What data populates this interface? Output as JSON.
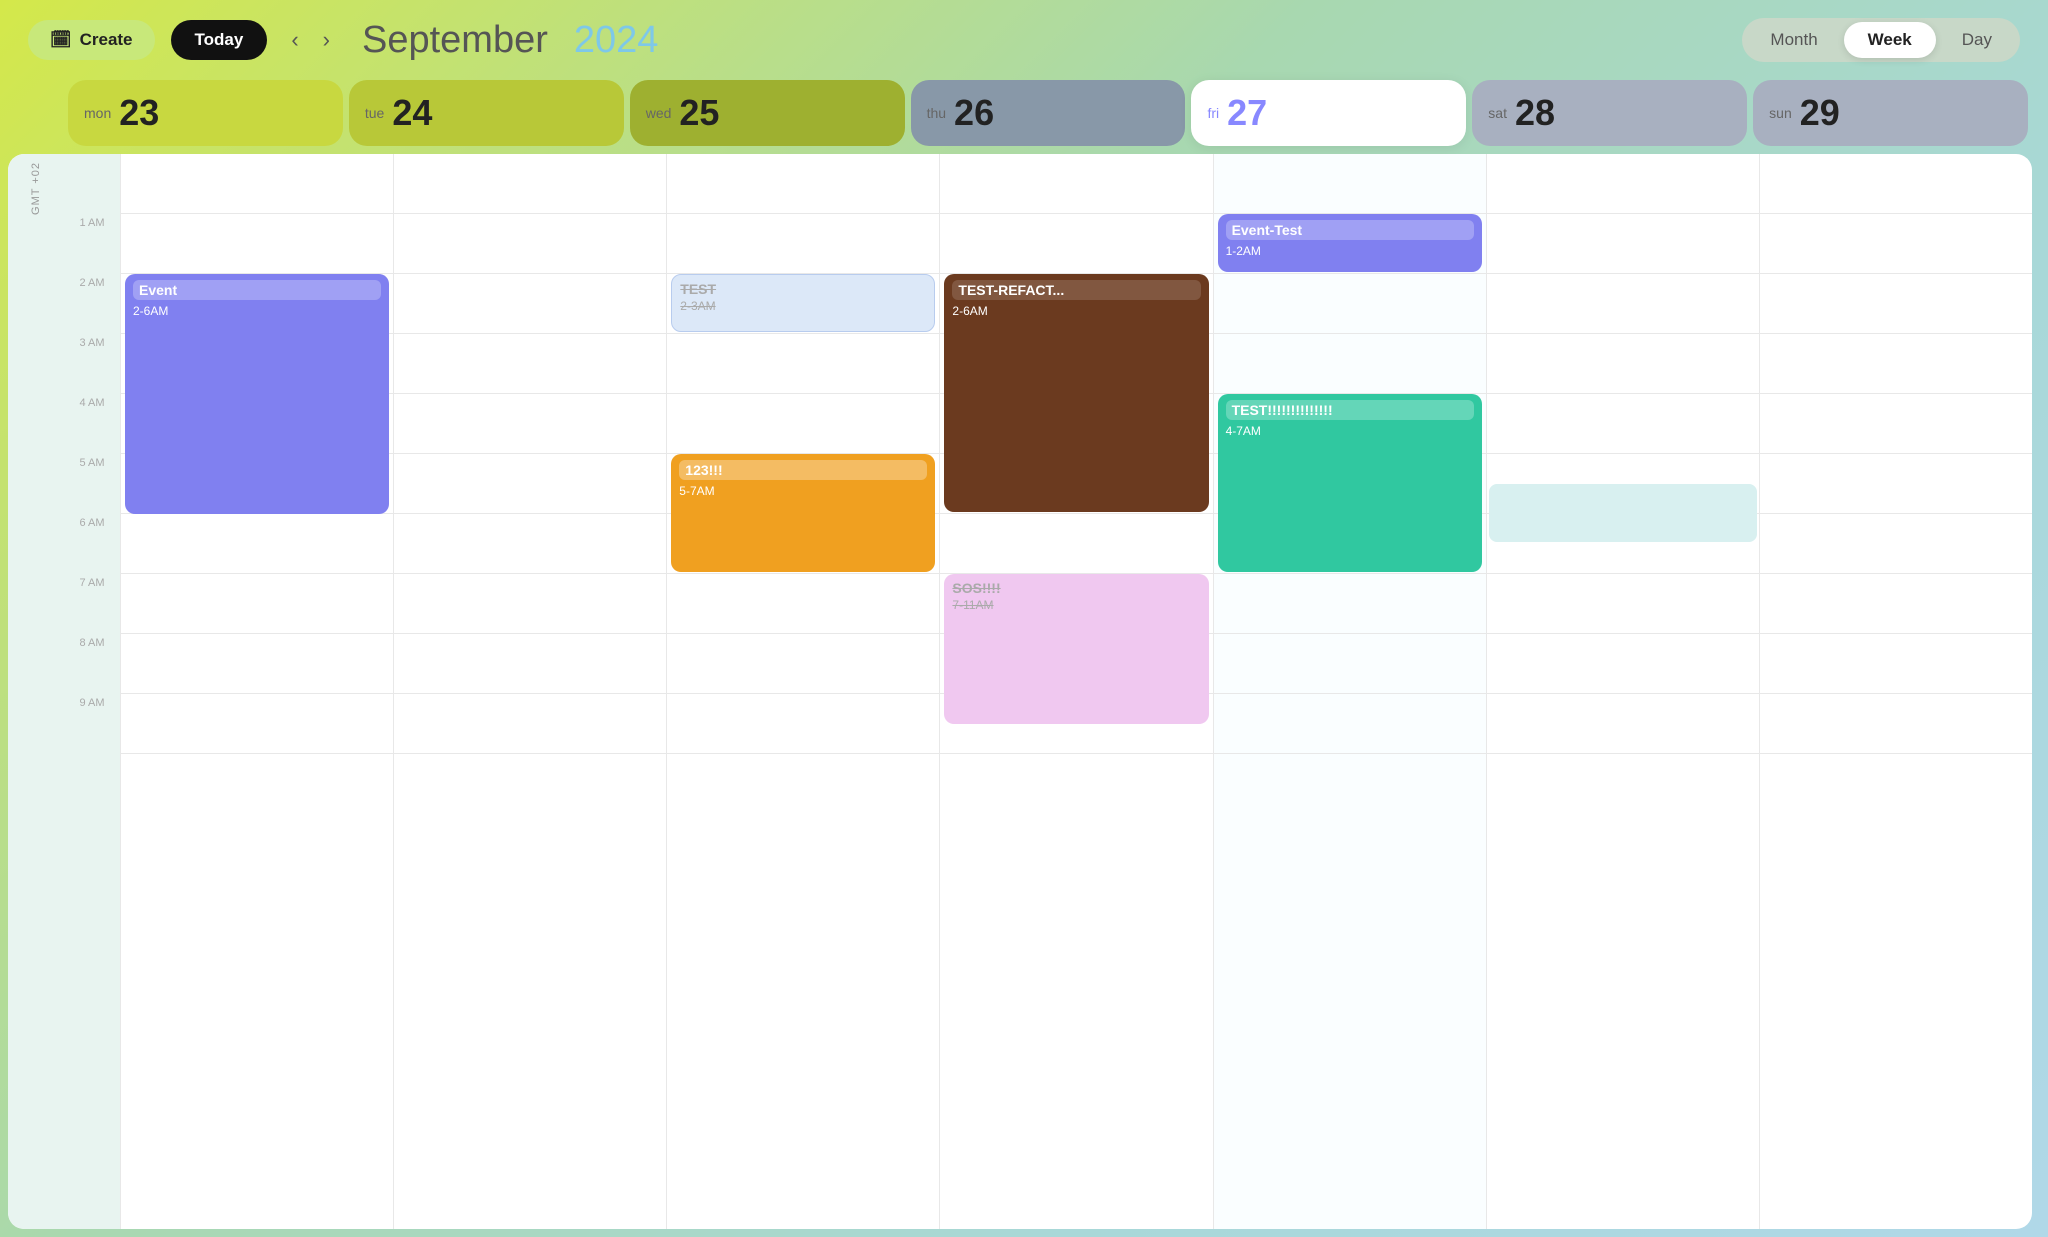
{
  "header": {
    "create_label": "Create",
    "today_label": "Today",
    "prev_arrow": "‹",
    "next_arrow": "›",
    "month_name": "September",
    "year": "2024",
    "views": [
      "Month",
      "Week",
      "Day"
    ],
    "active_view": "Week"
  },
  "days": [
    {
      "key": "mon",
      "name": "mon",
      "num": "23",
      "is_today": false
    },
    {
      "key": "tue",
      "name": "tue",
      "num": "24",
      "is_today": false
    },
    {
      "key": "wed",
      "name": "wed",
      "num": "25",
      "is_today": false
    },
    {
      "key": "thu",
      "name": "thu",
      "num": "26",
      "is_today": false
    },
    {
      "key": "fri",
      "name": "fri",
      "num": "27",
      "is_today": true
    },
    {
      "key": "sat",
      "name": "sat",
      "num": "28",
      "is_today": false
    },
    {
      "key": "sun",
      "name": "sun",
      "num": "29",
      "is_today": false
    }
  ],
  "gmt_label": "GMT +02",
  "time_labels": [
    "",
    "1 AM",
    "2 AM",
    "3 AM",
    "4 AM",
    "5 AM",
    "6 AM",
    "7 AM",
    "8 AM",
    "9 AM"
  ],
  "events": [
    {
      "id": "event-mon",
      "day": 0,
      "title": "Event",
      "title_bg": true,
      "time": "2-6AM",
      "color": "purple",
      "top_hour": 2,
      "span_hours": 4
    },
    {
      "id": "event-wed-test",
      "day": 2,
      "title": "TEST",
      "title_bg": false,
      "time": "2-3AM",
      "color": "light-blue",
      "top_hour": 2,
      "span_hours": 1
    },
    {
      "id": "event-wed-123",
      "day": 2,
      "title": "123!!!",
      "title_bg": true,
      "time": "5-7AM",
      "color": "orange",
      "top_hour": 5,
      "span_hours": 2
    },
    {
      "id": "event-thu-refact",
      "day": 3,
      "title": "TEST-REFACT...",
      "title_bg": false,
      "time": "2-6AM",
      "color": "brown",
      "top_hour": 2,
      "span_hours": 4
    },
    {
      "id": "event-thu-sos",
      "day": 3,
      "title": "SOS!!!!",
      "title_bg": false,
      "time": "7-11AM",
      "color": "pink",
      "top_hour": 7,
      "span_hours": 2.5
    },
    {
      "id": "event-fri-test",
      "day": 4,
      "title": "Event-Test",
      "title_bg": true,
      "time": "1-2AM",
      "color": "violet",
      "top_hour": 1,
      "span_hours": 1
    },
    {
      "id": "event-fri-testex",
      "day": 4,
      "title": "TEST!!!!!!!!!!!!!",
      "title_bg": true,
      "time": "4-7AM",
      "color": "teal",
      "top_hour": 4,
      "span_hours": 3
    },
    {
      "id": "event-sat-light",
      "day": 5,
      "title": "",
      "title_bg": false,
      "time": "",
      "color": "light-teal",
      "top_hour": 5.5,
      "span_hours": 1
    }
  ]
}
